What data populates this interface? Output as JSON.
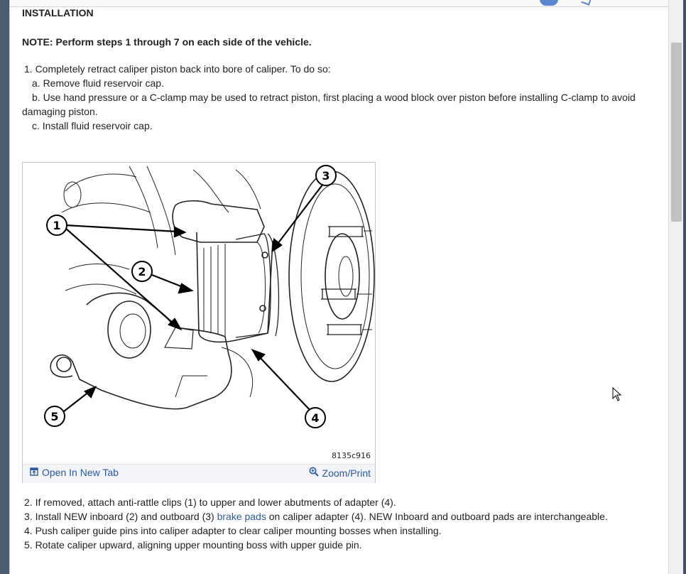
{
  "section": {
    "heading": "INSTALLATION",
    "note": "NOTE: Perform steps 1 through 7 on each side of the vehicle."
  },
  "steps_before": {
    "step1": "1. Completely retract caliper piston back into bore of caliper. To do so:",
    "step1a": "a. Remove fluid reservoir cap.",
    "step1b_line1": "b. Use hand pressure or a C-clamp may be used to retract piston, first placing a wood block over piston before installing C-clamp to avoid",
    "step1b_line2": "damaging piston.",
    "step1c": "c. Install fluid reservoir cap."
  },
  "figure": {
    "callouts": [
      "1",
      "2",
      "3",
      "4",
      "5"
    ],
    "code": "8135c916",
    "open_tab_label": "Open In New Tab",
    "zoom_label": "Zoom/Print",
    "open_tab_icon": "external-open-icon",
    "zoom_icon": "magnifier-icon"
  },
  "steps_after": {
    "step2": "2. If removed, attach anti-rattle clips (1) to upper and lower abutments of adapter (4).",
    "step3_pre": "3. Install NEW inboard (2) and outboard (3) ",
    "step3_link": "brake pads",
    "step3_post": " on caliper adapter (4). NEW Inboard and outboard pads are interchangeable.",
    "step4": "4. Push caliper guide pins into caliper adapter to clear caliper mounting bosses when installing.",
    "step5": "5. Rotate caliper upward, aligning upper mounting boss with upper guide pin."
  },
  "colors": {
    "link": "#2c5aa0",
    "chrome": "#3f5168"
  }
}
